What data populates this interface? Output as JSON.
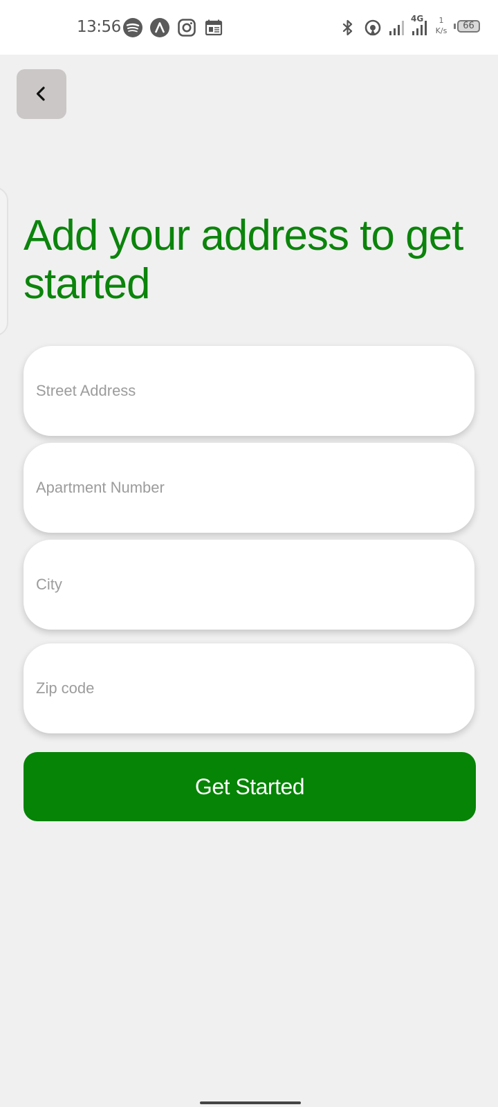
{
  "status_bar": {
    "time": "13:56",
    "network_type": "4G",
    "speed_value": "1",
    "speed_unit": "K/s",
    "battery": "66",
    "notification_icons": [
      "spotify-icon",
      "arc-icon",
      "instagram-icon",
      "calendar-icon"
    ],
    "system_icons": [
      "bluetooth-icon",
      "hotspot-icon",
      "signal-icon",
      "signal-4g-icon",
      "battery-icon"
    ]
  },
  "header": {
    "back_icon": "chevron-left-icon"
  },
  "main": {
    "title": "Add your address to get started",
    "fields": {
      "street": {
        "placeholder": "Street Address",
        "value": ""
      },
      "apartment": {
        "placeholder": "Apartment Number",
        "value": ""
      },
      "city": {
        "placeholder": "City",
        "value": ""
      },
      "zip": {
        "placeholder": "Zip code",
        "value": ""
      }
    },
    "submit_label": "Get Started"
  },
  "colors": {
    "accent": "#058405",
    "title": "#0b840b",
    "background": "#f0f0f0",
    "back_button": "#cbc7c6"
  }
}
